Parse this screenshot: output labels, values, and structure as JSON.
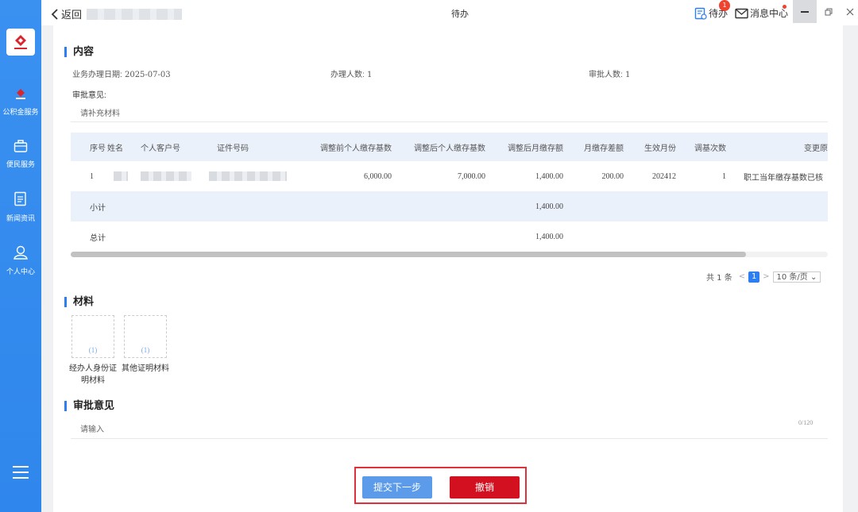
{
  "app": {
    "window_title": "待办",
    "back_label": "返回"
  },
  "header": {
    "todo_label": "待办",
    "todo_badge": "1",
    "messages_label": "消息中心"
  },
  "sidebar": {
    "items": [
      {
        "label": "公积金服务",
        "icon": "house-fund-icon"
      },
      {
        "label": "便民服务",
        "icon": "briefcase-icon"
      },
      {
        "label": "新闻资讯",
        "icon": "news-icon"
      },
      {
        "label": "个人中心",
        "icon": "user-icon"
      }
    ]
  },
  "content": {
    "section_title": "内容",
    "business_date_label": "业务办理日期:",
    "business_date": "2025-07-03",
    "handle_count_label": "办理人数:",
    "handle_count": "1",
    "approve_count_label": "审批人数:",
    "approve_count": "1",
    "opinion_label": "审批意见:",
    "opinion_text": "请补充材料"
  },
  "table": {
    "headers": [
      "序号",
      "姓名",
      "个人客户号",
      "证件号码",
      "调整前个人缴存基数",
      "调整后个人缴存基数",
      "调整后月缴存额",
      "月缴存差额",
      "生效月份",
      "调基次数",
      "变更原"
    ],
    "rows": [
      {
        "seq": "1",
        "before_base": "6,000.00",
        "after_base": "7,000.00",
        "monthly": "1,400.00",
        "diff": "200.00",
        "month": "202412",
        "times": "1",
        "reason": "职工当年缴存基数已核"
      }
    ],
    "subtotal_label": "小计",
    "subtotal_monthly": "1,400.00",
    "total_label": "总计",
    "total_monthly": "1,400.00"
  },
  "pagination": {
    "total_text": "共 1 条",
    "current_page": "1",
    "page_size": "10 条/页"
  },
  "materials": {
    "section_title": "材料",
    "items": [
      {
        "count": "(1)",
        "label": "经办人身份证明材料"
      },
      {
        "count": "(1)",
        "label": "其他证明材料"
      }
    ]
  },
  "review": {
    "section_title": "审批意见",
    "placeholder": "请输入",
    "char_count": "0/120"
  },
  "actions": {
    "submit_label": "提交下一步",
    "cancel_label": "撤销"
  },
  "colors": {
    "sidebar": "#2f86ec",
    "accent": "#2d7ef0",
    "danger": "#d3101f",
    "header_row": "#eaf1fb"
  }
}
